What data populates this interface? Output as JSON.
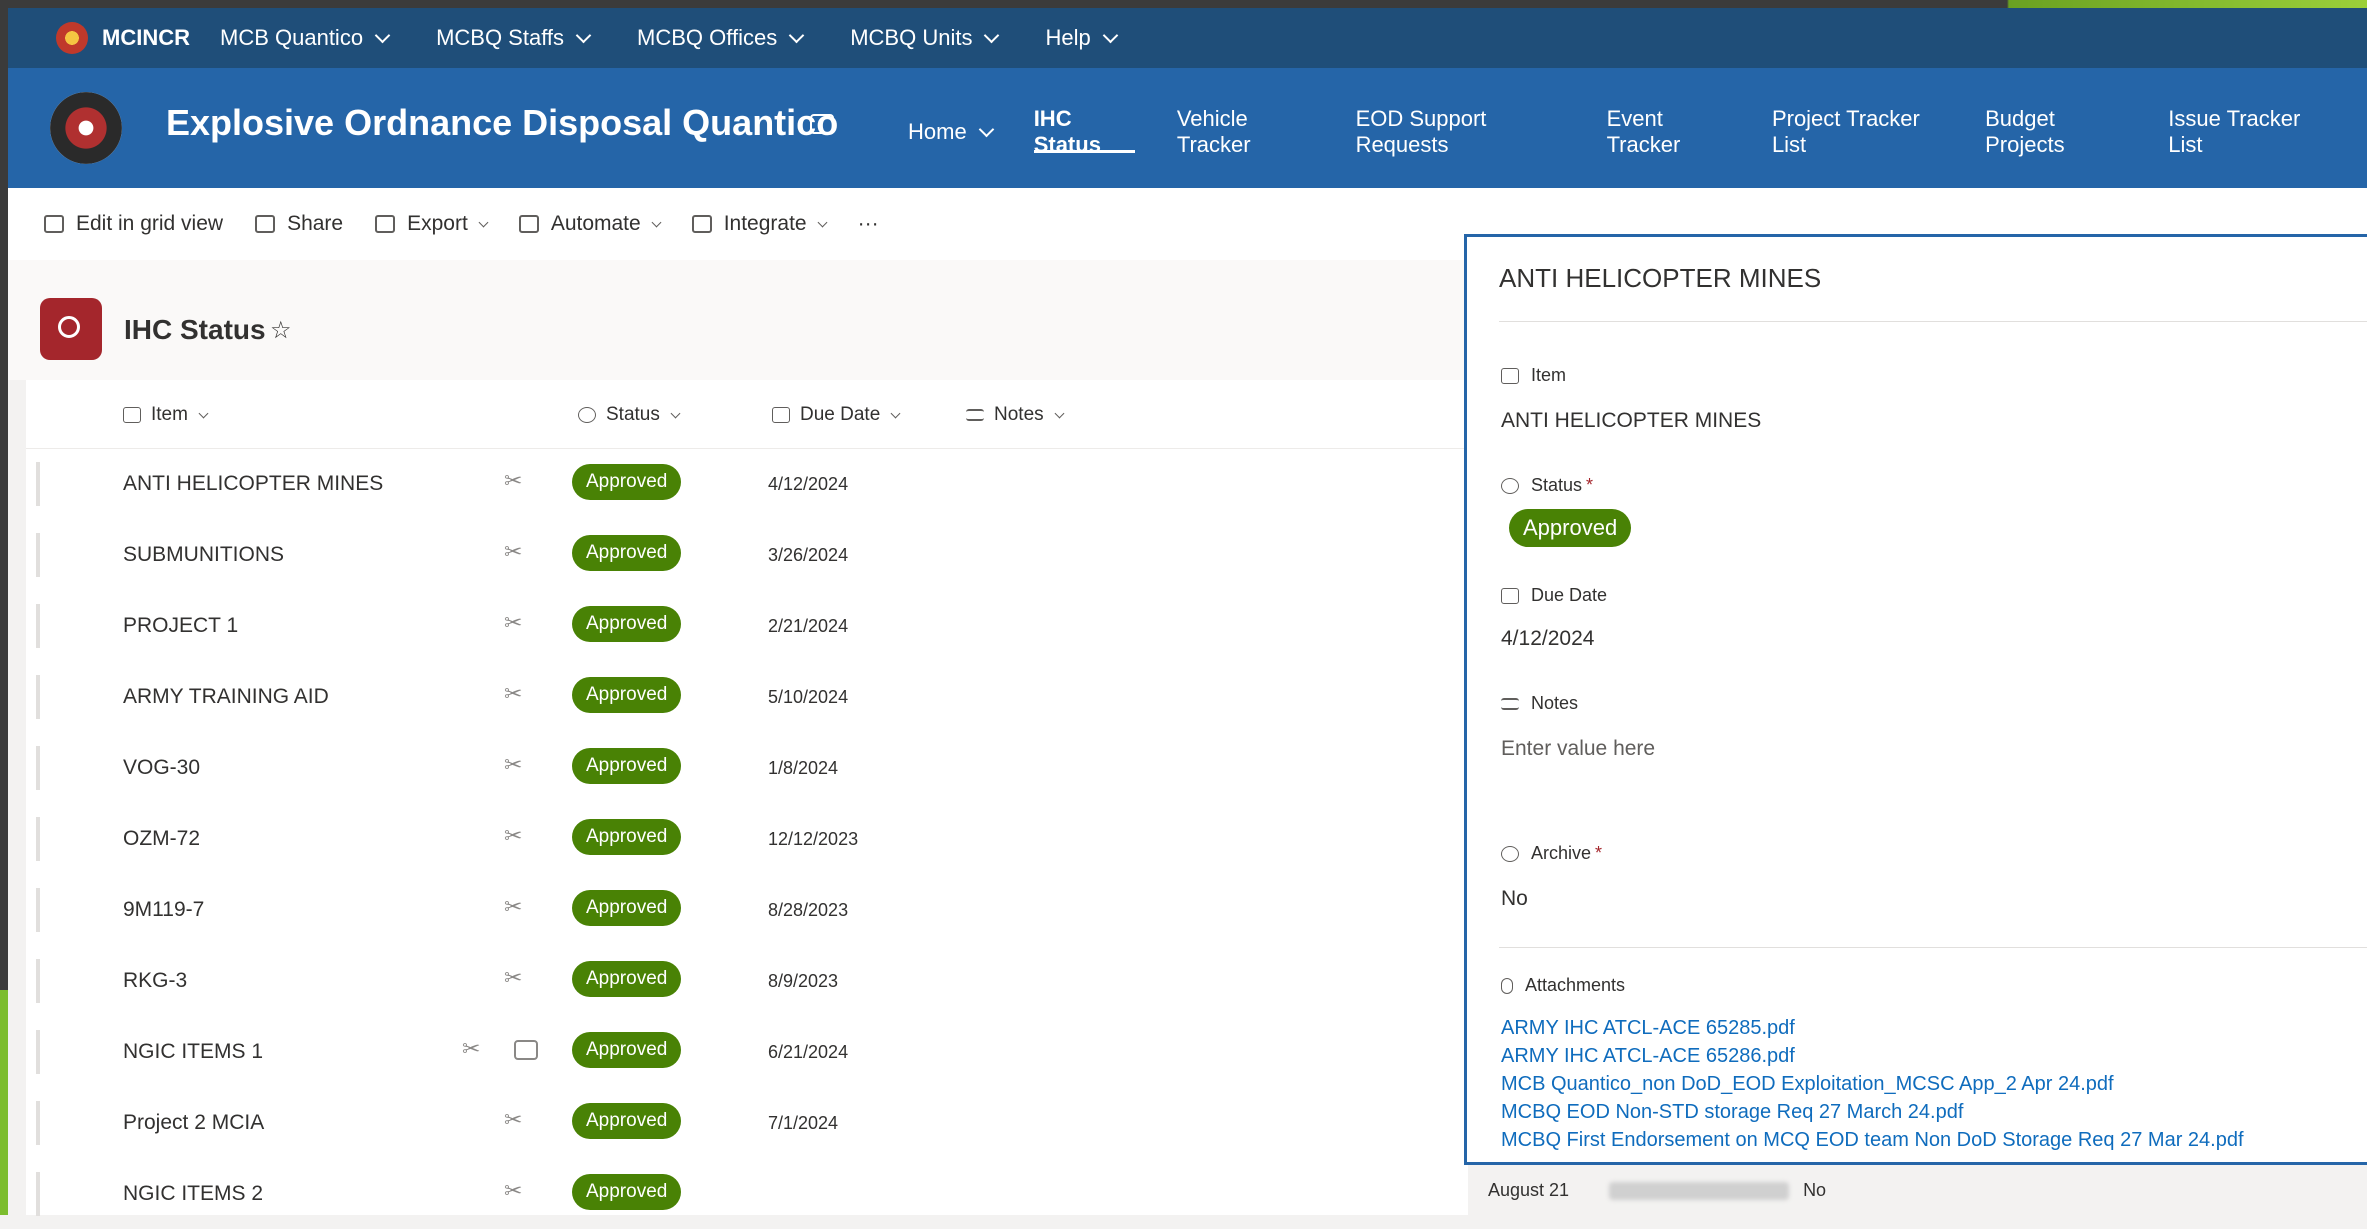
{
  "suite": {
    "brand": "MCINCR",
    "nav": [
      "MCB Quantico",
      "MCBQ Staffs",
      "MCBQ Offices",
      "MCBQ Units",
      "Help"
    ]
  },
  "site": {
    "title": "Explosive Ordnance Disposal Quantico",
    "nav": [
      "Home",
      "IHC Status",
      "Vehicle Tracker",
      "EOD Support Requests",
      "Event Tracker",
      "Project Tracker List",
      "Budget Projects",
      "Issue Tracker List"
    ],
    "active": "IHC Status"
  },
  "commands": {
    "edit_grid": "Edit in grid view",
    "share": "Share",
    "export": "Export",
    "automate": "Automate",
    "integrate": "Integrate",
    "more": "···"
  },
  "list": {
    "title": "IHC Status",
    "star": "☆"
  },
  "columns": {
    "item": "Item",
    "status": "Status",
    "due": "Due Date",
    "notes": "Notes"
  },
  "rows": [
    {
      "name": "ANTI HELICOPTER MINES",
      "status": "Approved",
      "due": "4/12/2024"
    },
    {
      "name": "SUBMUNITIONS",
      "status": "Approved",
      "due": "3/26/2024"
    },
    {
      "name": "PROJECT 1",
      "status": "Approved",
      "due": "2/21/2024"
    },
    {
      "name": "ARMY TRAINING AID",
      "status": "Approved",
      "due": "5/10/2024"
    },
    {
      "name": "VOG-30",
      "status": "Approved",
      "due": "1/8/2024"
    },
    {
      "name": "OZM-72",
      "status": "Approved",
      "due": "12/12/2023"
    },
    {
      "name": "9M119-7",
      "status": "Approved",
      "due": "8/28/2023"
    },
    {
      "name": "RKG-3",
      "status": "Approved",
      "due": "8/9/2023"
    },
    {
      "name": "NGIC ITEMS 1",
      "status": "Approved",
      "due": "6/21/2024"
    },
    {
      "name": "Project 2 MCIA",
      "status": "Approved",
      "due": "7/1/2024"
    },
    {
      "name": "NGIC ITEMS 2",
      "status": "Approved",
      "due": ""
    }
  ],
  "panel": {
    "title": "ANTI HELICOPTER MINES",
    "item_label": "Item",
    "item_value": "ANTI HELICOPTER MINES",
    "status_label": "Status",
    "status_value": "Approved",
    "required": "*",
    "due_label": "Due Date",
    "due_value": "4/12/2024",
    "notes_label": "Notes",
    "notes_placeholder": "Enter value here",
    "archive_label": "Archive",
    "archive_value": "No",
    "attachments_label": "Attachments",
    "attachments": [
      "ARMY IHC ATCL-ACE 65285.pdf",
      "ARMY IHC ATCL-ACE 65286.pdf",
      "MCB Quantico_non DoD_EOD Exploitation_MCSC App_2 Apr 24.pdf",
      "MCBQ EOD Non-STD storage Req 27 March 24.pdf",
      "MCBQ First Endorsement on MCQ EOD team Non DoD Storage Req 27 Mar 24.pdf"
    ]
  },
  "bottom": {
    "date": "August 21",
    "value": "No"
  }
}
